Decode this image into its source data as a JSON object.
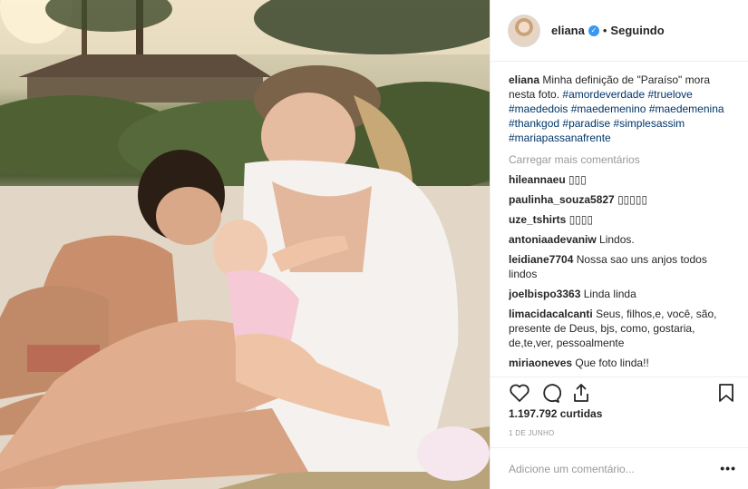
{
  "header": {
    "username": "eliana",
    "verified_icon": "verified-badge-icon",
    "separator": "•",
    "follow_status": "Seguindo"
  },
  "caption": {
    "username": "eliana",
    "text": "Minha definição de \"Paraíso\" mora nesta foto.",
    "hashtags": [
      "#amordeverdade",
      "#truelove",
      "#maededois",
      "#maedemenino",
      "#maedemenina",
      "#thankgod",
      "#paradise",
      "#simplesassim",
      "#mariapassanafrente"
    ]
  },
  "load_more": "Carregar mais comentários",
  "comments": [
    {
      "username": "hileannaeu",
      "text": "▯▯▯"
    },
    {
      "username": "paulinha_souza5827",
      "text": "▯▯▯▯▯"
    },
    {
      "username": "uze_tshirts",
      "text": "▯▯▯▯"
    },
    {
      "username": "antoniaadevaniw",
      "text": "Lindos."
    },
    {
      "username": "leidiane7704",
      "text": "Nossa sao uns anjos todos lindos"
    },
    {
      "username": "joelbispo3363",
      "text": "Linda linda"
    },
    {
      "username": "limacidacalcanti",
      "text": "Seus, filhos,e, você, são, presente de Deus, bjs, como, gostaria, de,te,ver, pessoalmente"
    },
    {
      "username": "miriaoneves",
      "text": "Que foto linda!!"
    }
  ],
  "actions": {
    "like_icon": "heart-icon",
    "comment_icon": "comment-icon",
    "share_icon": "share-icon",
    "save_icon": "bookmark-icon"
  },
  "likes": "1.197.792 curtidas",
  "date": "1 DE JUNHO",
  "add_comment": {
    "placeholder": "Adicione um comentário...",
    "more_label": "•••"
  },
  "colors": {
    "link": "#003569",
    "muted": "#999999",
    "text": "#262626",
    "verified": "#3897f0",
    "border": "#efefef"
  }
}
